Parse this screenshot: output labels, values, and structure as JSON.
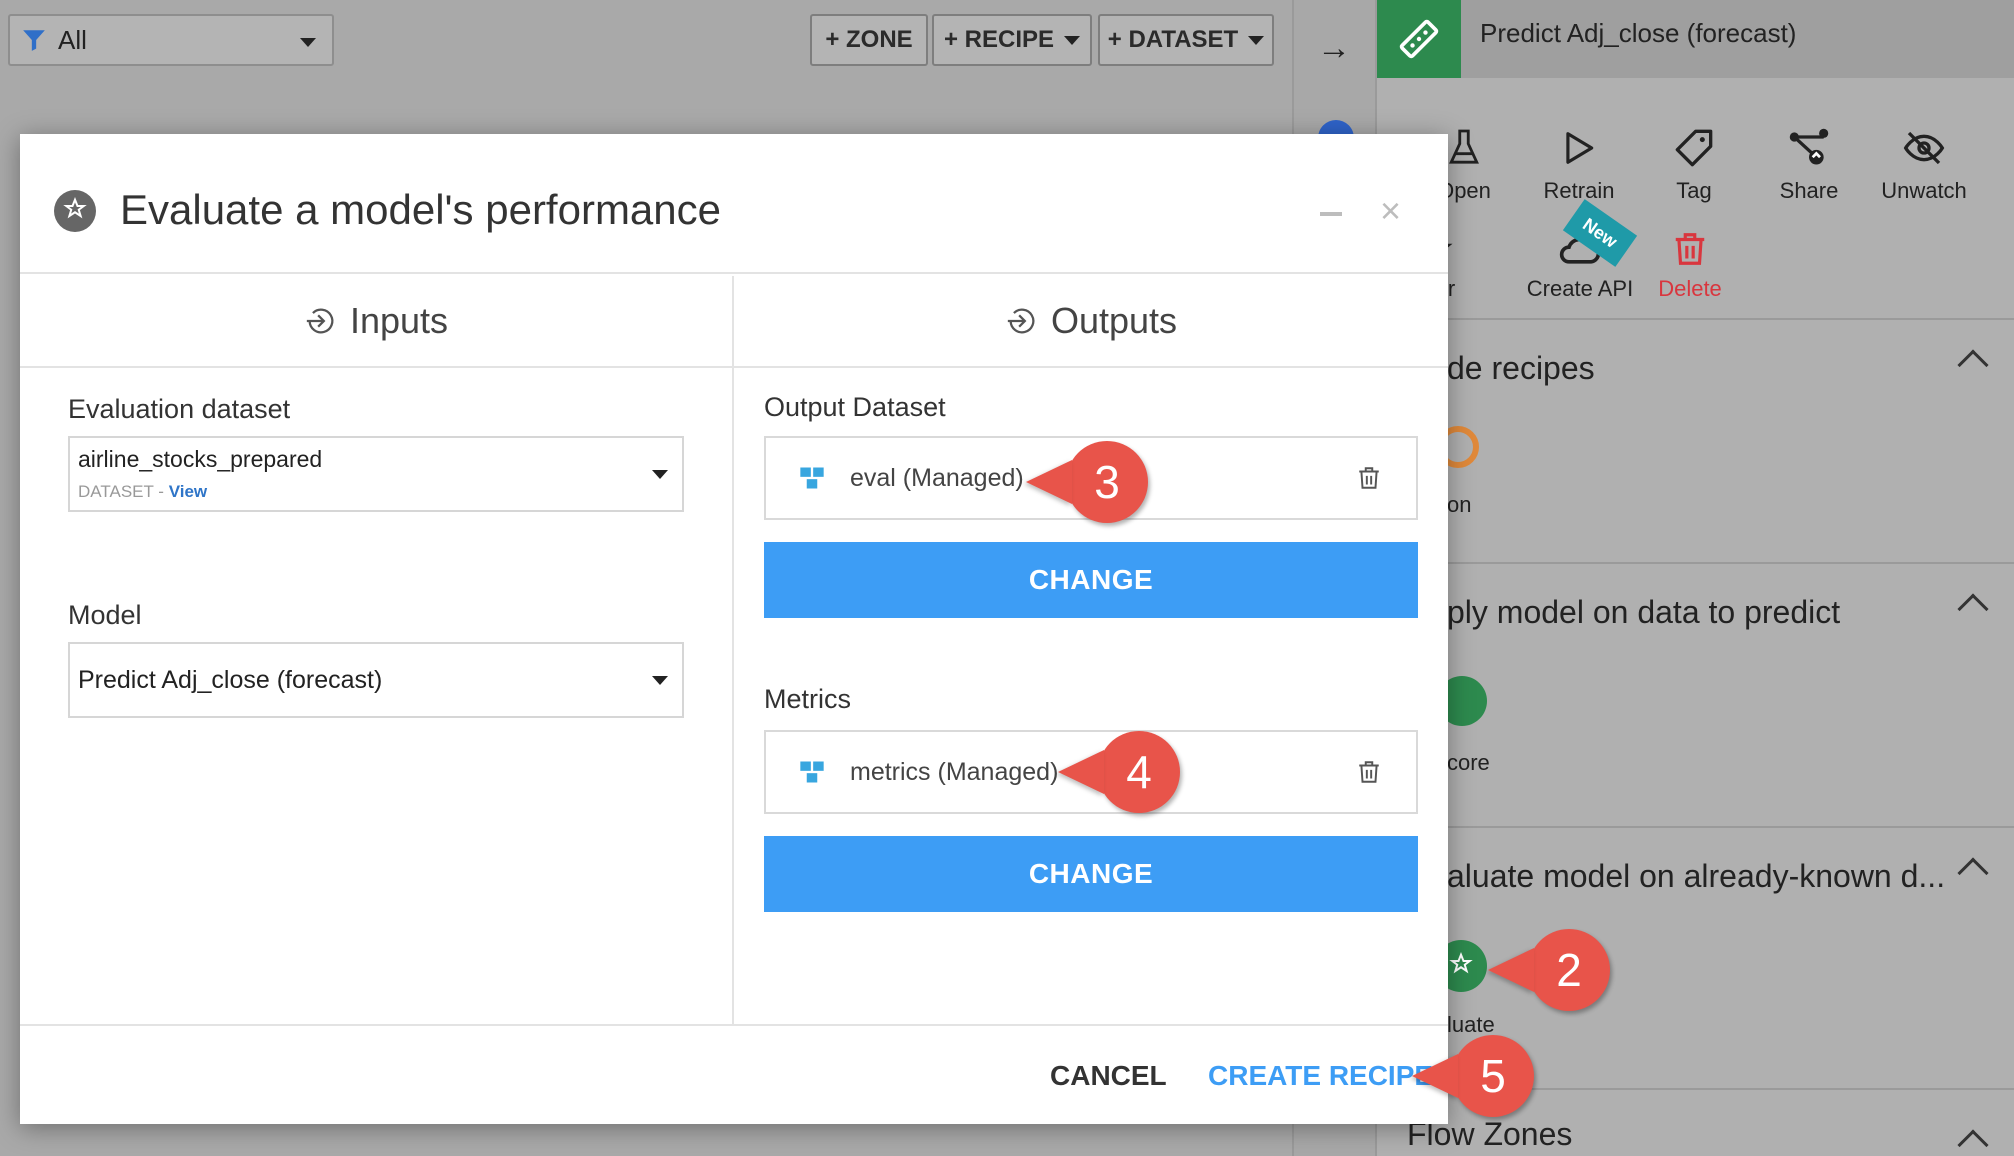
{
  "topbar": {
    "filter_value": "All",
    "zone_btn": "+ ZONE",
    "recipe_btn": "+ RECIPE",
    "dataset_btn": "+ DATASET"
  },
  "panel": {
    "title": "Predict Adj_close (forecast)",
    "actions": [
      "Open",
      "Retrain",
      "Tag",
      "Share",
      "Unwatch"
    ],
    "actions2": {
      "star": "Star",
      "create_api": "Create API",
      "new_badge": "New",
      "delete": "Delete"
    },
    "sections": [
      {
        "title": "de recipes",
        "sub": "on"
      },
      {
        "title": "ply model on data to predict",
        "sub": "core"
      },
      {
        "title": "aluate model on already-known d...",
        "sub": "luate"
      },
      {
        "title": "Flow Zones"
      }
    ]
  },
  "modal": {
    "title": "Evaluate a model's performance",
    "inputs_label": "Inputs",
    "outputs_label": "Outputs",
    "eval_dataset_label": "Evaluation dataset",
    "eval_dataset_value": "airline_stocks_prepared",
    "eval_dataset_type": "DATASET",
    "eval_dataset_sep": " - ",
    "eval_dataset_view": "View",
    "model_label": "Model",
    "model_value": "Predict Adj_close (forecast)",
    "output_dataset_label": "Output Dataset",
    "output_dataset_value": "eval (Managed)",
    "metrics_label": "Metrics",
    "metrics_value": "metrics (Managed)",
    "change_label": "CHANGE",
    "cancel_label": "CANCEL",
    "create_label": "CREATE RECIPE"
  },
  "callouts": {
    "c2": "2",
    "c3": "3",
    "c4": "4",
    "c5": "5"
  },
  "colors": {
    "accent": "#3d9df5",
    "callout": "#e8544a",
    "model_green": "#2d8a4e",
    "delete_red": "#d9363e"
  }
}
